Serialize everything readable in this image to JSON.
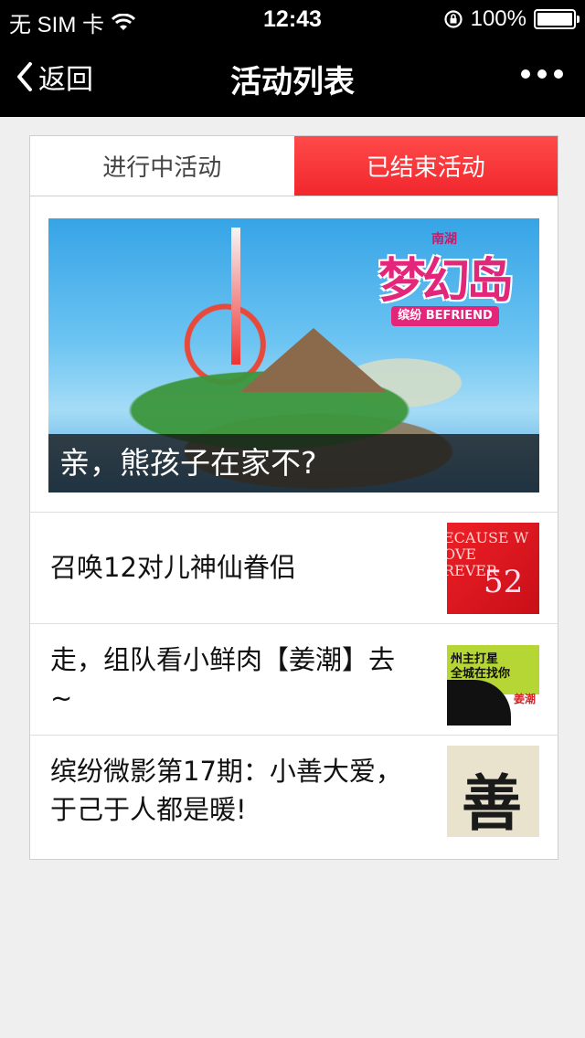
{
  "status_bar": {
    "carrier": "无 SIM 卡",
    "time": "12:43",
    "battery": "100%"
  },
  "nav": {
    "back_label": "返回",
    "title": "活动列表"
  },
  "tabs": [
    {
      "label": "进行中活动",
      "active": false
    },
    {
      "label": "已结束活动",
      "active": true
    }
  ],
  "featured": {
    "caption": "亲，熊孩子在家不?",
    "logo_top": "南湖",
    "logo_main": "梦幻岛",
    "logo_sub": "缤纷 BEFRIEND"
  },
  "events": [
    {
      "title": "召唤12对儿神仙眷侣",
      "thumb_text": [
        "ECAUSE W",
        "OVE",
        "REVER",
        "52"
      ]
    },
    {
      "title": "走，组队看小鲜肉【姜潮】去~",
      "thumb_text": [
        "州主打星",
        "全城在找你",
        "姜潮"
      ]
    },
    {
      "title": "缤纷微影第17期：小善大爱，于己于人都是暖!",
      "thumb_text": [
        "善"
      ]
    }
  ],
  "colors": {
    "active_tab": "#f1272d",
    "nav_bg": "#000000",
    "page_bg": "#efefef"
  }
}
